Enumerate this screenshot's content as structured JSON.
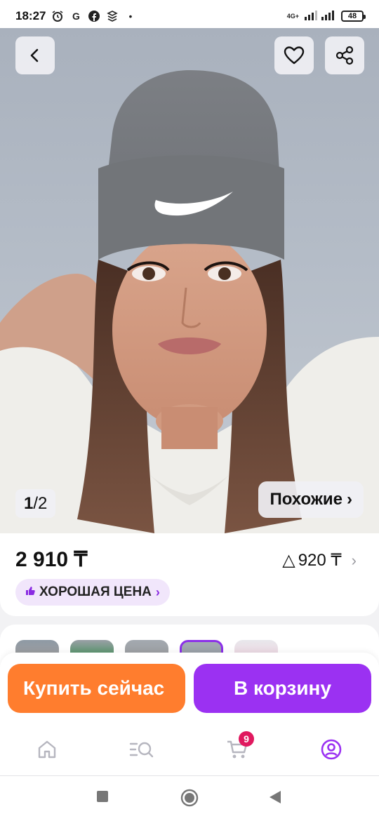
{
  "status_bar": {
    "time": "18:27",
    "status_icons": [
      "alarm-icon",
      "google-icon",
      "facebook-icon",
      "app-icon"
    ],
    "network_label": "4G+",
    "battery": "48"
  },
  "hero": {
    "counter_current": "1",
    "counter_total": "2",
    "similar_label": "Похожие",
    "chevron": "›",
    "icons": {
      "back": "back-arrow-icon",
      "favorite": "heart-icon",
      "share": "share-icon"
    }
  },
  "price": {
    "main": "2 910 ₸",
    "alt_prefix": "△",
    "alt": "920 ₸",
    "badge": "ХОРОШАЯ ЦЕНА",
    "badge_icon": "thumbs-up-icon"
  },
  "variants": {
    "selected_index": 3,
    "count_visible": 5
  },
  "actions": {
    "buy_now": "Купить сейчас",
    "add_to_cart": "В корзину"
  },
  "bottom_nav": {
    "items": [
      "home-icon",
      "catalog-search-icon",
      "cart-icon",
      "profile-icon"
    ],
    "cart_count": "9"
  },
  "colors": {
    "accent_purple": "#9b31f2",
    "accent_orange": "#ff7d2e",
    "badge_bg": "#f1e6fb",
    "cart_badge": "#e0195f"
  }
}
